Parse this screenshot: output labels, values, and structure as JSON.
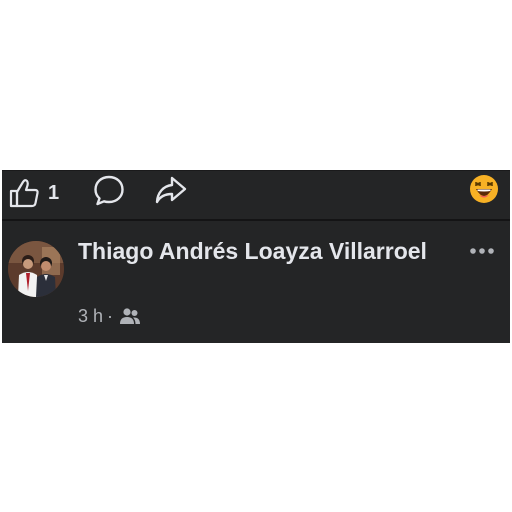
{
  "actions": {
    "like_count": "1",
    "like_icon": "thumbs-up-icon",
    "comment_icon": "comment-bubble-icon",
    "share_icon": "share-arrow-icon",
    "reaction_icon": "laughing-face-icon"
  },
  "comment": {
    "author": "Thiago Andrés Loayza Villarroel",
    "time": "3 h",
    "separator": "·",
    "audience_icon": "friends-icon",
    "more_icon": "more-dots-icon"
  },
  "colors": {
    "panel_bg": "#242526",
    "text_primary": "#e4e6eb",
    "text_secondary": "#b0b3b8",
    "reaction_yellow": "#f7b125"
  }
}
